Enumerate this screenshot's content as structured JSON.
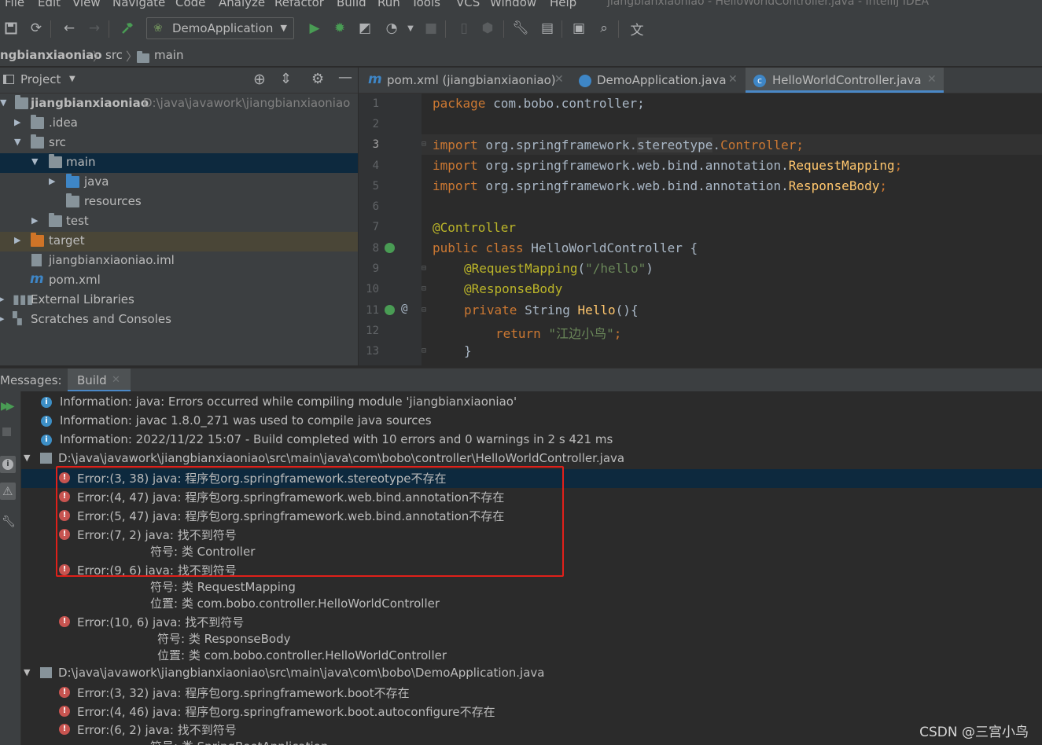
{
  "menu": [
    "File",
    "Edit",
    "View",
    "Navigate",
    "Code",
    "Analyze",
    "Refactor",
    "Build",
    "Run",
    "Tools",
    "VCS",
    "Window",
    "Help"
  ],
  "window_title": "jiangbianxiaoniao - HelloWorldController.java - IntelliJ IDEA",
  "toolbar": {
    "run_config": "DemoApplication"
  },
  "breadcrumb": [
    "ngbianxiaoniao",
    "src",
    "main"
  ],
  "project": {
    "header": "Project",
    "root_name": "jiangbianxiaoniao",
    "root_path": "D:\\java\\javawork\\jiangbianxiaoniao",
    "items": [
      ".idea",
      "src",
      "main",
      "java",
      "resources",
      "test",
      "target",
      "jiangbianxiaoniao.iml",
      "pom.xml",
      "External Libraries",
      "Scratches and Consoles"
    ]
  },
  "tabs": [
    "pom.xml (jiangbianxiaoniao)",
    "DemoApplication.java",
    "HelloWorldController.java"
  ],
  "editor": {
    "line_numbers": [
      "1",
      "2",
      "3",
      "4",
      "5",
      "6",
      "7",
      "8",
      "9",
      "10",
      "11",
      "12",
      "13"
    ],
    "l1_kw": "package",
    "l1_rest": " com.bobo.controller;",
    "import_kw": "import",
    "l3_pkg": " org.springframework.",
    "l3_mid": "stereotype",
    "l3_dot": ".",
    "l3_cls": "Controller",
    "l3_semi": ";",
    "l4_pkg": " org.springframework.web.bind.annotation.",
    "l4_cls": "RequestMapping",
    "l4_semi": ";",
    "l5_pkg": " org.springframework.web.bind.annotation.",
    "l5_cls": "ResponseBody",
    "l5_semi": ";",
    "l7_ann": "@Controller",
    "l8_kw": "public class",
    "l8_rest": " HelloWorldController {",
    "l9_ann": "@RequestMapping",
    "l9_open": "(",
    "l9_str": "\"/hello\"",
    "l9_close": ")",
    "l10_ann": "@ResponseBody",
    "l11_kw": "private",
    "l11_type": " String ",
    "l11_fn": "Hello",
    "l11_rest": "(){",
    "l12_kw": "return",
    "l12_str": " \"江边小鸟\"",
    "l12_semi": ";",
    "l13": "}",
    "gutter_at": "@"
  },
  "messages": {
    "label": "Messages:",
    "tab": "Build",
    "lines": [
      "Information: java: Errors occurred while compiling module 'jiangbianxiaoniao'",
      "Information: javac 1.8.0_271 was used to compile java sources",
      "Information: 2022/11/22 15:07 - Build completed with 10 errors and 0 warnings in 2 s 421 ms",
      "D:\\java\\javawork\\jiangbianxiaoniao\\src\\main\\java\\com\\bobo\\controller\\HelloWorldController.java",
      "Error:(3, 38)  java: 程序包org.springframework.stereotype不存在",
      "Error:(4, 47)  java: 程序包org.springframework.web.bind.annotation不存在",
      "Error:(5, 47)  java: 程序包org.springframework.web.bind.annotation不存在",
      "Error:(7, 2)  java: 找不到符号",
      "符号: 类 Controller",
      "Error:(9, 6)  java: 找不到符号",
      "符号:  类 RequestMapping",
      "位置: 类 com.bobo.controller.HelloWorldController",
      "Error:(10, 6)  java: 找不到符号",
      "符号:  类 ResponseBody",
      "位置: 类 com.bobo.controller.HelloWorldController",
      "D:\\java\\javawork\\jiangbianxiaoniao\\src\\main\\java\\com\\bobo\\DemoApplication.java",
      "Error:(3, 32)  java: 程序包org.springframework.boot不存在",
      "Error:(4, 46)  java: 程序包org.springframework.boot.autoconfigure不存在",
      "Error:(6, 2)  java: 找不到符号",
      "符号: 类 SpringBootApplication"
    ]
  },
  "watermark": "CSDN @三宫小鸟"
}
